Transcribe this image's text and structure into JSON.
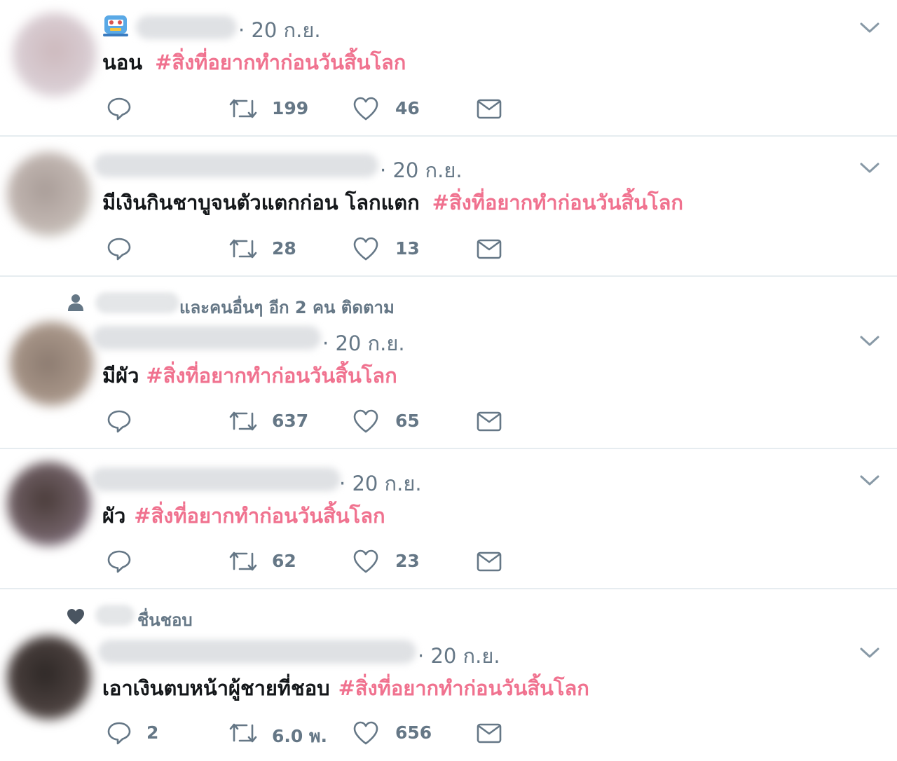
{
  "colors": {
    "hashtag": "#f0728f",
    "meta": "#657786",
    "text": "#14171a",
    "divider": "#e6ecf0"
  },
  "icons": [
    "reply-icon",
    "retweet-icon",
    "like-icon",
    "dm-icon",
    "chevron-down-icon",
    "person-icon",
    "heart-icon"
  ],
  "tweets": [
    {
      "date": "20 ก.ย.",
      "text": "นอน",
      "hashtag": "#สิ่งที่อยากทำก่อนวันสิ้นโลก",
      "reply_count": "",
      "retweet_count": "199",
      "like_count": "46"
    },
    {
      "date": "20 ก.ย.",
      "text": "มีเงินกินชาบูจนตัวแตกก่อน โลกแตก",
      "hashtag": "#สิ่งที่อยากทำก่อนวันสิ้นโลก",
      "reply_count": "",
      "retweet_count": "28",
      "like_count": "13"
    },
    {
      "context": "และคนอื่นๆ อีก 2 คน ติดตาม",
      "date": "20 ก.ย.",
      "text": "มีผัว",
      "hashtag": "#สิ่งที่อยากทำก่อนวันสิ้นโลก",
      "reply_count": "",
      "retweet_count": "637",
      "like_count": "65"
    },
    {
      "date": "20 ก.ย.",
      "text": "ผัว",
      "hashtag": "#สิ่งที่อยากทำก่อนวันสิ้นโลก",
      "reply_count": "",
      "retweet_count": "62",
      "like_count": "23"
    },
    {
      "context": "ชื่นชอบ",
      "date": "20 ก.ย.",
      "text": "เอาเงินตบหน้าผู้ชายที่ชอบ",
      "hashtag": "#สิ่งที่อยากทำก่อนวันสิ้นโลก",
      "reply_count": "2",
      "retweet_count": "6.0 พ.",
      "like_count": "656"
    }
  ]
}
